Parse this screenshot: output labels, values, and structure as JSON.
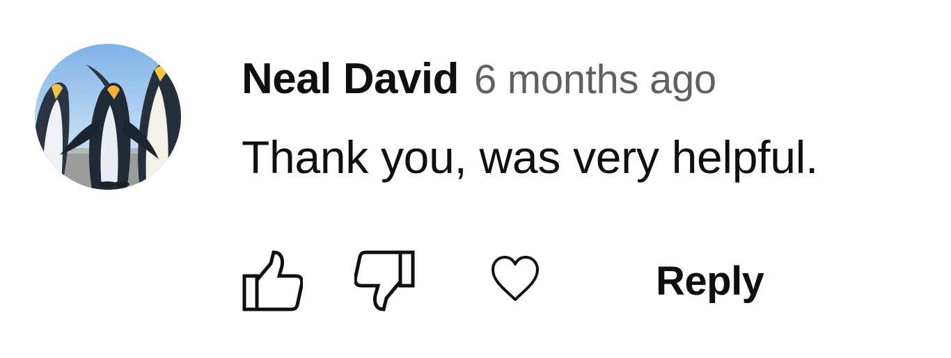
{
  "comment": {
    "author": "Neal David",
    "time": "6 months ago",
    "text": "Thank you, was very helpful.",
    "avatar_icon": "penguins-avatar"
  },
  "actions": {
    "like_icon": "thumbs-up-icon",
    "dislike_icon": "thumbs-down-icon",
    "heart_icon": "heart-icon",
    "reply_label": "Reply"
  }
}
